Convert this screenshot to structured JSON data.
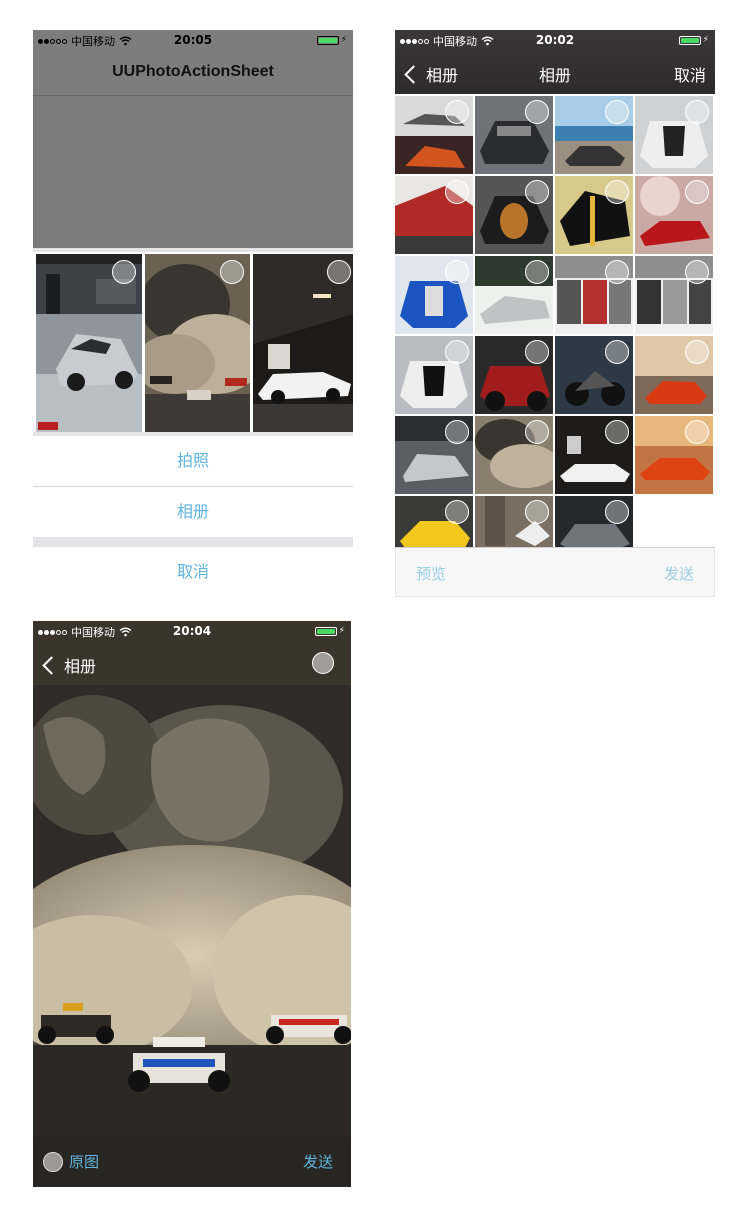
{
  "status": {
    "carrier": "中国移动",
    "time_screen1": "20:05",
    "time_screen2": "20:02",
    "time_screen3": "20:04"
  },
  "screen1": {
    "title": "UUPhotoActionSheet",
    "actions": {
      "take_photo": "拍照",
      "album": "相册",
      "cancel": "取消"
    }
  },
  "screen2": {
    "back_label": "相册",
    "title": "相册",
    "cancel": "取消",
    "preview": "预览",
    "send": "发送"
  },
  "screen3": {
    "back_label": "相册",
    "original": "原图",
    "send": "发送"
  },
  "colors": {
    "accent": "#5fb4dd",
    "accent_disabled": "#9ccde6",
    "battery": "#4cd964"
  },
  "icons": [
    "signal-dots-icon",
    "wifi-icon",
    "battery-icon",
    "chevron-left-icon",
    "select-circle-icon"
  ]
}
